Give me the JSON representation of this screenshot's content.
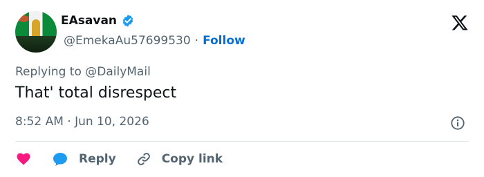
{
  "author": {
    "name": "EAsavan",
    "handle": "@EmekaAu57699530",
    "separator": "·",
    "follow_label": "Follow",
    "verified_icon": "verified-badge-icon"
  },
  "replying_to": "Replying to @DailyMail",
  "tweet": {
    "text": "That' total disrespect",
    "timestamp": "8:52 AM · Jun 10, 2026"
  },
  "actions": {
    "like_icon": "heart-icon",
    "reply_label": "Reply",
    "copy_label": "Copy link"
  },
  "icons": {
    "brand": "x-logo-icon",
    "info": "info-icon"
  },
  "colors": {
    "accent": "#006fd6",
    "verified": "#1d9bf0",
    "like": "#f91880",
    "reply": "#1d9bf0",
    "muted": "#536471",
    "text": "#0f1419"
  }
}
